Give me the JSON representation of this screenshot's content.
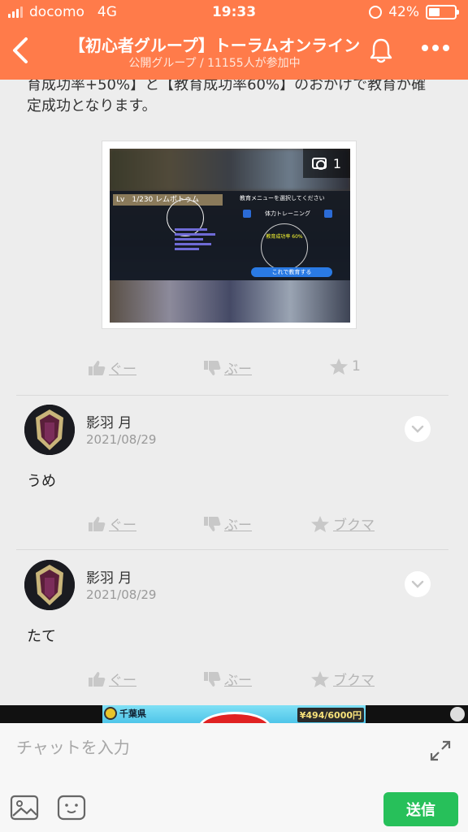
{
  "status_bar": {
    "carrier": "docomo",
    "network": "4G",
    "time": "19:33",
    "battery": "42%"
  },
  "header": {
    "title": "【初心者グループ】トーラムオンライン",
    "subtitle": "公開グループ / 11155人が参加中"
  },
  "post": {
    "text": "育成功率+50%】と【教育成功率60%】のおかげで教育が確定成功となります。",
    "photo_count": "1",
    "photo": {
      "level_bar": "Lv　1/230 レムボトゥム",
      "menu_title": "教育メニューを選択してください",
      "menu_item": "体力トレーニング",
      "success_rate": "教育成功率 60%",
      "button": "これで教育する"
    },
    "reactions": {
      "good_label": "ぐー",
      "boo_label": "ぶー",
      "star_count": "1"
    }
  },
  "comments": [
    {
      "name": "影羽 月",
      "date": "2021/08/29",
      "text": "うめ",
      "good_label": "ぐー",
      "boo_label": "ぶー",
      "bookmark_label": "ブクマ"
    },
    {
      "name": "影羽 月",
      "date": "2021/08/29",
      "text": "たて",
      "good_label": "ぐー",
      "boo_label": "ぶー",
      "bookmark_label": "ブクマ"
    }
  ],
  "ad": {
    "left_text": "千葉県",
    "right_text": "¥494/6000円"
  },
  "composer": {
    "placeholder": "チャットを入力",
    "send_label": "送信"
  },
  "colors": {
    "header_bg": "#ff7b4a",
    "send_button": "#27c05a"
  }
}
